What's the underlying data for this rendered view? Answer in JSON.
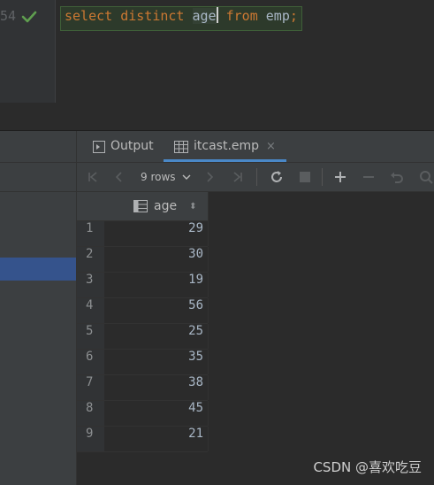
{
  "editor": {
    "line_number": "54",
    "query": {
      "kw_select": "select",
      "kw_distinct": "distinct",
      "ident_age": "age",
      "kw_from": "from",
      "ident_table": "emp",
      "semicolon": ";"
    }
  },
  "tabs": [
    {
      "label": "Output",
      "icon": "console-icon"
    },
    {
      "label": "itcast.emp",
      "icon": "table-icon",
      "close": "×"
    }
  ],
  "toolbar": {
    "rows_label": "9 rows",
    "icons": [
      "first-page-icon",
      "prev-page-icon",
      "next-page-icon",
      "last-page-icon",
      "refresh-icon",
      "stop-icon",
      "add-row-icon",
      "delete-row-icon",
      "revert-icon",
      "search-icon"
    ]
  },
  "grid": {
    "column": "age",
    "sort_glyph": "⬍",
    "rows": [
      {
        "num": "1",
        "age": "29"
      },
      {
        "num": "2",
        "age": "30"
      },
      {
        "num": "3",
        "age": "19"
      },
      {
        "num": "4",
        "age": "56"
      },
      {
        "num": "5",
        "age": "25"
      },
      {
        "num": "6",
        "age": "35"
      },
      {
        "num": "7",
        "age": "38"
      },
      {
        "num": "8",
        "age": "45"
      },
      {
        "num": "9",
        "age": "21"
      }
    ]
  },
  "watermark": "CSDN @喜欢吃豆",
  "colors": {
    "keyword": "#cc7832",
    "text": "#a9b7c6",
    "check": "#5f9e4f",
    "accent": "#4a88c7",
    "selection": "#2f65ca"
  }
}
